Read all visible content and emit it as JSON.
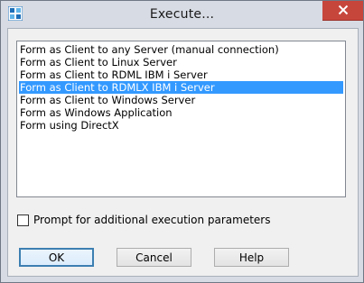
{
  "window": {
    "title": "Execute..."
  },
  "icons": {
    "app": "app-icon",
    "close": "close-icon"
  },
  "colors": {
    "selection": "#3399ff",
    "close_button": "#c7463c"
  },
  "list": {
    "items": [
      {
        "label": "Form as Client to any Server (manual connection)",
        "selected": false
      },
      {
        "label": "Form as Client to Linux Server",
        "selected": false
      },
      {
        "label": "Form as Client to RDML IBM i Server",
        "selected": false
      },
      {
        "label": "Form as Client to RDMLX IBM i Server",
        "selected": true
      },
      {
        "label": "Form as Client to Windows Server",
        "selected": false
      },
      {
        "label": "Form as Windows Application",
        "selected": false
      },
      {
        "label": "Form using DirectX",
        "selected": false
      }
    ]
  },
  "options": {
    "prompt_label": "Prompt for additional execution parameters",
    "prompt_checked": false
  },
  "buttons": {
    "ok": "OK",
    "cancel": "Cancel",
    "help": "Help"
  }
}
